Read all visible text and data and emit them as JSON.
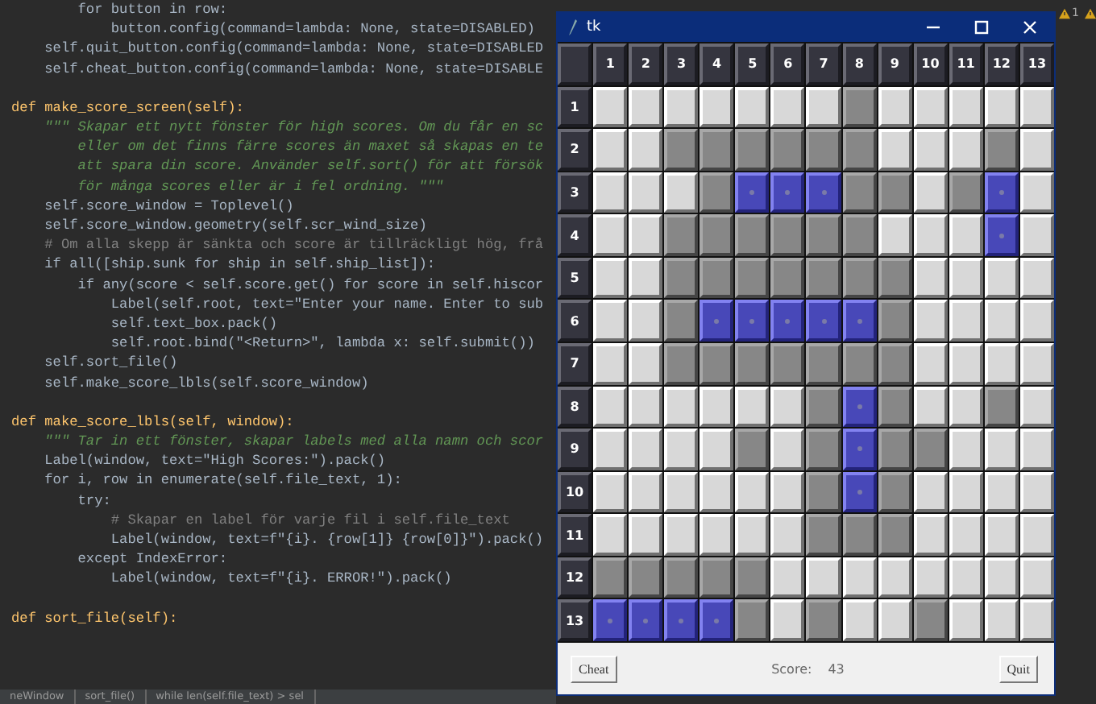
{
  "editor": {
    "blocks": [
      [
        {
          "text": "        for button in row:",
          "kind": "code"
        },
        {
          "text": "            button.config(command=lambda: None, state=DISABLED)",
          "kind": "code"
        },
        {
          "text": "    self.quit_button.config(command=lambda: None, state=DISABLED",
          "kind": "code"
        },
        {
          "text": "    self.cheat_button.config(command=lambda: None, state=DISABLE",
          "kind": "code"
        }
      ],
      [
        {
          "text": "def make_score_screen(self):",
          "kind": "def"
        },
        {
          "text": "    \"\"\" Skapar ett nytt fönster för high scores. Om du får en sc",
          "kind": "docstring"
        },
        {
          "text": "        eller om det finns färre scores än maxet så skapas en te",
          "kind": "docstring"
        },
        {
          "text": "        att spara din score. Använder self.sort() för att försök",
          "kind": "docstring"
        },
        {
          "text": "        för många scores eller är i fel ordning. \"\"\"",
          "kind": "docstring"
        },
        {
          "text": "    self.score_window = Toplevel()",
          "kind": "code"
        },
        {
          "text": "    self.score_window.geometry(self.scr_wind_size)",
          "kind": "code"
        },
        {
          "text": "    # Om alla skepp är sänkta och score är tillräckligt hög, frå",
          "kind": "comment"
        },
        {
          "text": "    if all([ship.sunk for ship in self.ship_list]):",
          "kind": "code"
        },
        {
          "text": "        if any(score < self.score.get() for score in self.hiscor",
          "kind": "code"
        },
        {
          "text": "            Label(self.root, text=\"Enter your name. Enter to sub",
          "kind": "code"
        },
        {
          "text": "            self.text_box.pack()",
          "kind": "code"
        },
        {
          "text": "            self.root.bind(\"<Return>\", lambda x: self.submit())",
          "kind": "code"
        },
        {
          "text": "    self.sort_file()",
          "kind": "code"
        },
        {
          "text": "    self.make_score_lbls(self.score_window)",
          "kind": "code"
        }
      ],
      [
        {
          "text": "def make_score_lbls(self, window):",
          "kind": "def"
        },
        {
          "text": "    \"\"\" Tar in ett fönster, skapar labels med alla namn och scor",
          "kind": "docstring"
        },
        {
          "text": "    Label(window, text=\"High Scores:\").pack()",
          "kind": "code"
        },
        {
          "text": "    for i, row in enumerate(self.file_text, 1):",
          "kind": "code"
        },
        {
          "text": "        try:",
          "kind": "code"
        },
        {
          "text": "            # Skapar en label för varje fil i self.file_text",
          "kind": "comment"
        },
        {
          "text": "            Label(window, text=f\"{i}. {row[1]} {row[0]}\").pack()",
          "kind": "code"
        },
        {
          "text": "        except IndexError:",
          "kind": "code"
        },
        {
          "text": "            Label(window, text=f\"{i}. ERROR!\").pack()",
          "kind": "code"
        }
      ],
      [
        {
          "text": "def sort_file(self):",
          "kind": "def"
        }
      ]
    ],
    "warning_count": "1",
    "status_bar": [
      "neWindow",
      "sort_file()",
      "while len(self.file_text) > sel"
    ]
  },
  "window": {
    "title": "tk",
    "column_headers": [
      "1",
      "2",
      "3",
      "4",
      "5",
      "6",
      "7",
      "8",
      "9",
      "10",
      "11",
      "12",
      "13"
    ],
    "rows": [
      {
        "header": "1",
        "cells": [
          {
            "kind": "empty"
          },
          {
            "kind": "empty"
          },
          {
            "kind": "empty"
          },
          {
            "kind": "empty"
          },
          {
            "kind": "empty"
          },
          {
            "kind": "empty"
          },
          {
            "kind": "empty"
          },
          {
            "kind": "miss"
          },
          {
            "kind": "empty"
          },
          {
            "kind": "empty"
          },
          {
            "kind": "empty"
          },
          {
            "kind": "empty"
          },
          {
            "kind": "empty"
          }
        ]
      },
      {
        "header": "2",
        "cells": [
          {
            "kind": "empty"
          },
          {
            "kind": "empty"
          },
          {
            "kind": "miss"
          },
          {
            "kind": "miss"
          },
          {
            "kind": "miss"
          },
          {
            "kind": "miss"
          },
          {
            "kind": "miss"
          },
          {
            "kind": "miss"
          },
          {
            "kind": "empty"
          },
          {
            "kind": "empty"
          },
          {
            "kind": "empty"
          },
          {
            "kind": "miss"
          },
          {
            "kind": "empty"
          }
        ]
      },
      {
        "header": "3",
        "cells": [
          {
            "kind": "empty"
          },
          {
            "kind": "empty"
          },
          {
            "kind": "empty"
          },
          {
            "kind": "miss"
          },
          {
            "kind": "hit"
          },
          {
            "kind": "hit"
          },
          {
            "kind": "hit"
          },
          {
            "kind": "miss"
          },
          {
            "kind": "miss"
          },
          {
            "kind": "empty"
          },
          {
            "kind": "miss"
          },
          {
            "kind": "hit"
          },
          {
            "kind": "empty"
          }
        ]
      },
      {
        "header": "4",
        "cells": [
          {
            "kind": "empty"
          },
          {
            "kind": "empty"
          },
          {
            "kind": "miss"
          },
          {
            "kind": "miss"
          },
          {
            "kind": "miss"
          },
          {
            "kind": "miss"
          },
          {
            "kind": "miss"
          },
          {
            "kind": "miss"
          },
          {
            "kind": "empty"
          },
          {
            "kind": "empty"
          },
          {
            "kind": "empty"
          },
          {
            "kind": "hit"
          },
          {
            "kind": "empty"
          }
        ]
      },
      {
        "header": "5",
        "cells": [
          {
            "kind": "empty"
          },
          {
            "kind": "empty"
          },
          {
            "kind": "miss"
          },
          {
            "kind": "miss"
          },
          {
            "kind": "miss"
          },
          {
            "kind": "miss"
          },
          {
            "kind": "miss"
          },
          {
            "kind": "miss"
          },
          {
            "kind": "miss"
          },
          {
            "kind": "empty"
          },
          {
            "kind": "empty"
          },
          {
            "kind": "empty"
          },
          {
            "kind": "empty"
          }
        ]
      },
      {
        "header": "6",
        "cells": [
          {
            "kind": "empty"
          },
          {
            "kind": "empty"
          },
          {
            "kind": "miss"
          },
          {
            "kind": "hit"
          },
          {
            "kind": "hit"
          },
          {
            "kind": "hit"
          },
          {
            "kind": "hit"
          },
          {
            "kind": "hit"
          },
          {
            "kind": "miss"
          },
          {
            "kind": "empty"
          },
          {
            "kind": "empty"
          },
          {
            "kind": "empty"
          },
          {
            "kind": "empty"
          }
        ]
      },
      {
        "header": "7",
        "cells": [
          {
            "kind": "empty"
          },
          {
            "kind": "empty"
          },
          {
            "kind": "miss"
          },
          {
            "kind": "miss"
          },
          {
            "kind": "miss"
          },
          {
            "kind": "miss"
          },
          {
            "kind": "miss"
          },
          {
            "kind": "miss"
          },
          {
            "kind": "miss"
          },
          {
            "kind": "empty"
          },
          {
            "kind": "empty"
          },
          {
            "kind": "empty"
          },
          {
            "kind": "empty"
          }
        ]
      },
      {
        "header": "8",
        "cells": [
          {
            "kind": "empty"
          },
          {
            "kind": "empty"
          },
          {
            "kind": "empty"
          },
          {
            "kind": "empty"
          },
          {
            "kind": "empty"
          },
          {
            "kind": "empty"
          },
          {
            "kind": "miss"
          },
          {
            "kind": "hit"
          },
          {
            "kind": "miss"
          },
          {
            "kind": "empty"
          },
          {
            "kind": "empty"
          },
          {
            "kind": "miss"
          },
          {
            "kind": "empty"
          }
        ]
      },
      {
        "header": "9",
        "cells": [
          {
            "kind": "empty"
          },
          {
            "kind": "empty"
          },
          {
            "kind": "empty"
          },
          {
            "kind": "empty"
          },
          {
            "kind": "miss"
          },
          {
            "kind": "empty"
          },
          {
            "kind": "miss"
          },
          {
            "kind": "hit"
          },
          {
            "kind": "miss"
          },
          {
            "kind": "miss"
          },
          {
            "kind": "empty"
          },
          {
            "kind": "empty"
          },
          {
            "kind": "empty"
          }
        ]
      },
      {
        "header": "10",
        "cells": [
          {
            "kind": "empty"
          },
          {
            "kind": "empty"
          },
          {
            "kind": "empty"
          },
          {
            "kind": "empty"
          },
          {
            "kind": "empty"
          },
          {
            "kind": "empty"
          },
          {
            "kind": "miss"
          },
          {
            "kind": "hit"
          },
          {
            "kind": "miss"
          },
          {
            "kind": "empty"
          },
          {
            "kind": "empty"
          },
          {
            "kind": "empty"
          },
          {
            "kind": "empty"
          }
        ]
      },
      {
        "header": "11",
        "cells": [
          {
            "kind": "empty"
          },
          {
            "kind": "empty"
          },
          {
            "kind": "empty"
          },
          {
            "kind": "empty"
          },
          {
            "kind": "empty"
          },
          {
            "kind": "empty"
          },
          {
            "kind": "miss"
          },
          {
            "kind": "miss"
          },
          {
            "kind": "miss"
          },
          {
            "kind": "empty"
          },
          {
            "kind": "empty"
          },
          {
            "kind": "empty"
          },
          {
            "kind": "empty"
          }
        ]
      },
      {
        "header": "12",
        "cells": [
          {
            "kind": "miss"
          },
          {
            "kind": "miss"
          },
          {
            "kind": "miss"
          },
          {
            "kind": "miss"
          },
          {
            "kind": "miss"
          },
          {
            "kind": "empty"
          },
          {
            "kind": "empty"
          },
          {
            "kind": "empty"
          },
          {
            "kind": "empty"
          },
          {
            "kind": "empty"
          },
          {
            "kind": "empty"
          },
          {
            "kind": "empty"
          },
          {
            "kind": "empty"
          }
        ]
      },
      {
        "header": "13",
        "cells": [
          {
            "kind": "hit"
          },
          {
            "kind": "hit"
          },
          {
            "kind": "hit"
          },
          {
            "kind": "hit"
          },
          {
            "kind": "miss"
          },
          {
            "kind": "empty"
          },
          {
            "kind": "miss"
          },
          {
            "kind": "empty"
          },
          {
            "kind": "empty"
          },
          {
            "kind": "miss"
          },
          {
            "kind": "empty"
          },
          {
            "kind": "empty"
          },
          {
            "kind": "empty"
          }
        ]
      }
    ],
    "cheat_button": "Cheat",
    "score_label": "Score:",
    "score": "43",
    "quit_button": "Quit"
  }
}
